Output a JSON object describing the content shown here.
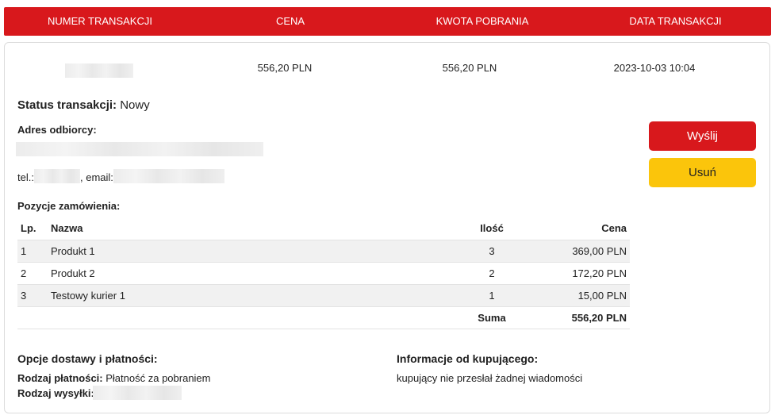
{
  "header": {
    "columns": [
      "NUMER TRANSAKCJI",
      "CENA",
      "KWOTA POBRANIA",
      "DATA TRANSAKCJI"
    ]
  },
  "summary": {
    "price": "556,20 PLN",
    "cod_amount": "556,20 PLN",
    "date": "2023-10-03 10:04"
  },
  "status": {
    "label": "Status transakcji:",
    "value": "Nowy"
  },
  "address": {
    "label": "Adres odbiorcy:",
    "tel_label": "tel.:",
    "email_label": ", email:"
  },
  "actions": {
    "send_label": "Wyślij",
    "delete_label": "Usuń"
  },
  "order": {
    "label": "Pozycje zamówienia:",
    "headers": {
      "lp": "Lp.",
      "name": "Nazwa",
      "qty": "Ilość",
      "price": "Cena"
    },
    "rows": [
      {
        "lp": "1",
        "name": "Produkt 1",
        "qty": "3",
        "price": "369,00 PLN"
      },
      {
        "lp": "2",
        "name": "Produkt 2",
        "qty": "2",
        "price": "172,20 PLN"
      },
      {
        "lp": "3",
        "name": "Testowy kurier 1",
        "qty": "1",
        "price": "15,00 PLN"
      }
    ],
    "sum_label": "Suma",
    "sum_value": "556,20 PLN"
  },
  "delivery": {
    "label": "Opcje dostawy i płatności:",
    "payment_label": "Rodzaj płatności:",
    "payment_value": "Płatność za pobraniem",
    "shipping_label": "Rodzaj wysyłki:"
  },
  "buyer_info": {
    "label": "Informacje od kupującego:",
    "message": "kupujący nie przesłał żadnej wiadomości"
  },
  "colors": {
    "primary_red": "#d8181c",
    "warning_yellow": "#fbc50b"
  }
}
